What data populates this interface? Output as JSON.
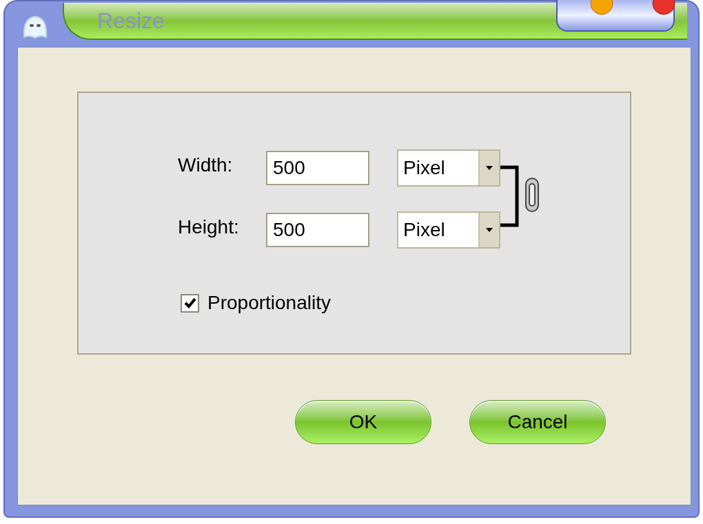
{
  "window": {
    "title": "Resize"
  },
  "fields": [
    {
      "label": "Width:",
      "value": "500",
      "unit": "Pixel"
    },
    {
      "label": "Height:",
      "value": "500",
      "unit": "Pixel"
    }
  ],
  "proportionality": {
    "label": "Proportionality",
    "checked": true
  },
  "buttons": [
    "OK",
    "Cancel"
  ]
}
